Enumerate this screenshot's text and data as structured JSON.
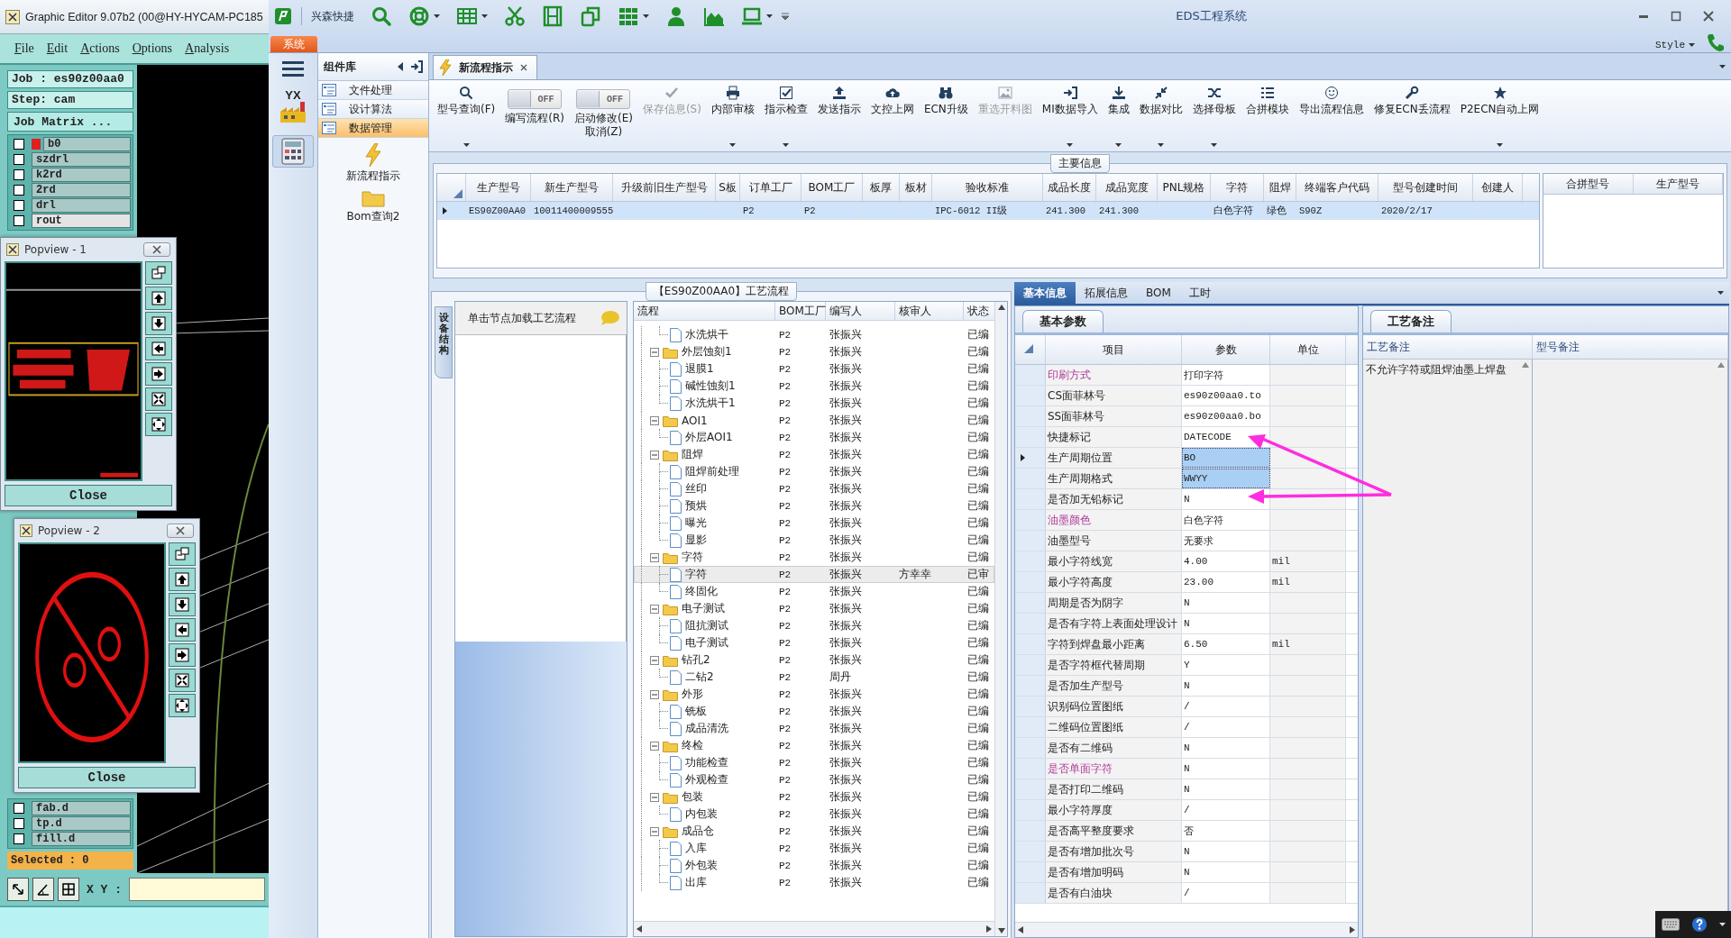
{
  "cam_window": {
    "title": "Graphic Editor 9.07b2 (00@HY-HYCAM-PC185",
    "menu": [
      "File",
      "Edit",
      "Actions",
      "Options",
      "Analysis"
    ],
    "job": "Job : es90z00aa0",
    "step": "Step: cam",
    "job_matrix": "Job Matrix ...",
    "layers": [
      {
        "name": "b0",
        "color": "#e02020",
        "selected": false,
        "checked": false
      },
      {
        "name": "szdrl",
        "selected": false,
        "checked": false
      },
      {
        "name": "k2rd",
        "selected": false,
        "checked": false
      },
      {
        "name": "2rd",
        "selected": false,
        "checked": false
      },
      {
        "name": "drl",
        "selected": false,
        "checked": false
      },
      {
        "name": "rout",
        "selected": true,
        "checked": false
      }
    ],
    "bottom_layers": [
      {
        "name": "fab.d",
        "selected": false,
        "checked": false
      },
      {
        "name": "tp.d",
        "selected": false,
        "checked": false
      },
      {
        "name": "fill.d",
        "selected": false,
        "checked": false
      }
    ],
    "selected_count": "Selected : 0",
    "xy_label": "X Y :",
    "popviews": [
      {
        "title": "Popview - 1",
        "close": "Close"
      },
      {
        "title": "Popview - 2",
        "close": "Close"
      }
    ]
  },
  "eds": {
    "title": "EDS工程系统",
    "quick_label": "兴森快捷",
    "system_tab": "系统",
    "style": "Style",
    "nav_badge": "YX",
    "components": {
      "title": "组件库",
      "items": [
        {
          "label": "文件处理",
          "selected": false
        },
        {
          "label": "设计算法",
          "selected": false
        },
        {
          "label": "数据管理",
          "selected": true
        }
      ],
      "tools": [
        "新流程指示",
        "Bom查询2"
      ]
    },
    "doc_tab": "新流程指示",
    "toolbar": [
      {
        "kind": "button",
        "label": "型号查询(F)",
        "dropdown": true,
        "disabled": false
      },
      {
        "kind": "toggle",
        "label": "编写流程(R)",
        "state_text": "OFF",
        "on": false
      },
      {
        "kind": "toggle",
        "label": "启动修改(E)\n取消(Z)",
        "state_text": "OFF",
        "on": false
      },
      {
        "kind": "button",
        "label": "保存信息(S)",
        "dropdown": false,
        "disabled": true
      },
      {
        "kind": "button",
        "label": "内部审核",
        "dropdown": true,
        "disabled": false
      },
      {
        "kind": "button",
        "label": "指示检查",
        "dropdown": true,
        "disabled": false
      },
      {
        "kind": "button",
        "label": "发送指示",
        "dropdown": false,
        "disabled": false
      },
      {
        "kind": "button",
        "label": "文控上网",
        "dropdown": false,
        "disabled": false
      },
      {
        "kind": "button",
        "label": "ECN升级",
        "dropdown": false,
        "disabled": false
      },
      {
        "kind": "button",
        "label": "重选开料图",
        "dropdown": false,
        "disabled": true
      },
      {
        "kind": "button",
        "label": "MI数据导入",
        "dropdown": true,
        "disabled": false
      },
      {
        "kind": "button",
        "label": "集成",
        "dropdown": true,
        "disabled": false
      },
      {
        "kind": "button",
        "label": "数据对比",
        "dropdown": true,
        "disabled": false
      },
      {
        "kind": "button",
        "label": "选择母板",
        "dropdown": true,
        "disabled": false
      },
      {
        "kind": "button",
        "label": "合拼模块",
        "dropdown": false,
        "disabled": false
      },
      {
        "kind": "button",
        "label": "导出流程信息",
        "dropdown": false,
        "disabled": false
      },
      {
        "kind": "button",
        "label": "修复ECN丢流程",
        "dropdown": false,
        "disabled": false
      },
      {
        "kind": "button",
        "label": "P2ECN自动上网",
        "dropdown": true,
        "disabled": false
      }
    ],
    "main_info": {
      "title": "主要信息",
      "columns": [
        "生产型号",
        "新生产型号",
        "升级前旧生产型号",
        "S板",
        "订单工厂",
        "BOM工厂",
        "板厚",
        "板材",
        "验收标准",
        "成品长度",
        "成品宽度",
        "PNL规格",
        "字符",
        "阻焊",
        "终端客户代码",
        "型号创建时间",
        "创建人"
      ],
      "rows": [
        {
          "selected": true,
          "cells": [
            "ES90Z00AA0",
            "10011400009555",
            null,
            null,
            "P2",
            "P2",
            null,
            null,
            "IPC-6012 II级",
            "241.300",
            "241.300",
            null,
            "白色字符",
            "绿色",
            "S90Z",
            "2020/2/17",
            null
          ]
        }
      ],
      "side_columns": [
        "合拼型号",
        "生产型号"
      ]
    },
    "process": {
      "title": "【ES90Z00AA0】工艺流程",
      "side_tab": "设备结构",
      "hint": "单击节点加载工艺流程",
      "columns": [
        "流程",
        "BOM工厂",
        "编写人",
        "核审人",
        "状态"
      ],
      "tree": [
        {
          "children": [
            {
              "name": "水洗烘干",
              "factory": "P2",
              "author": "张振兴",
              "status": "已编",
              "selected": false
            }
          ]
        },
        {
          "name": "外层蚀刻1",
          "factory": "P2",
          "author": "张振兴",
          "status": "已编",
          "selected": false,
          "children": [
            {
              "name": "退膜1",
              "factory": "P2",
              "author": "张振兴",
              "status": "已编",
              "selected": false
            },
            {
              "name": "碱性蚀刻1",
              "factory": "P2",
              "author": "张振兴",
              "status": "已编",
              "selected": false
            },
            {
              "name": "水洗烘干1",
              "factory": "P2",
              "author": "张振兴",
              "status": "已编",
              "selected": false
            }
          ]
        },
        {
          "name": "AOI1",
          "factory": "P2",
          "author": "张振兴",
          "status": "已编",
          "selected": false,
          "children": [
            {
              "name": "外层AOI1",
              "factory": "P2",
              "author": "张振兴",
              "status": "已编",
              "selected": false
            }
          ]
        },
        {
          "name": "阻焊",
          "factory": "P2",
          "author": "张振兴",
          "status": "已编",
          "selected": false,
          "children": [
            {
              "name": "阻焊前处理",
              "factory": "P2",
              "author": "张振兴",
              "status": "已编",
              "selected": false
            },
            {
              "name": "丝印",
              "factory": "P2",
              "author": "张振兴",
              "status": "已编",
              "selected": false
            },
            {
              "name": "预烘",
              "factory": "P2",
              "author": "张振兴",
              "status": "已编",
              "selected": false
            },
            {
              "name": "曝光",
              "factory": "P2",
              "author": "张振兴",
              "status": "已编",
              "selected": false
            },
            {
              "name": "显影",
              "factory": "P2",
              "author": "张振兴",
              "status": "已编",
              "selected": false
            }
          ]
        },
        {
          "name": "字符",
          "factory": "P2",
          "author": "张振兴",
          "status": "已编",
          "selected": false,
          "children": [
            {
              "name": "字符",
              "factory": "P2",
              "author": "张振兴",
              "reviewer": "方幸幸",
              "status": "已审",
              "selected": true
            },
            {
              "name": "终固化",
              "factory": "P2",
              "author": "张振兴",
              "status": "已编",
              "selected": false
            }
          ]
        },
        {
          "name": "电子测试",
          "factory": "P2",
          "author": "张振兴",
          "status": "已编",
          "selected": false,
          "children": [
            {
              "name": "阻抗测试",
              "factory": "P2",
              "author": "张振兴",
              "status": "已编",
              "selected": false
            },
            {
              "name": "电子测试",
              "factory": "P2",
              "author": "张振兴",
              "status": "已编",
              "selected": false
            }
          ]
        },
        {
          "name": "钻孔2",
          "factory": "P2",
          "author": "张振兴",
          "status": "已编",
          "selected": false,
          "children": [
            {
              "name": "二钻2",
              "factory": "P2",
              "author": "周丹",
              "status": "已编",
              "selected": false
            }
          ]
        },
        {
          "name": "外形",
          "factory": "P2",
          "author": "张振兴",
          "status": "已编",
          "selected": false,
          "children": [
            {
              "name": "铣板",
              "factory": "P2",
              "author": "张振兴",
              "status": "已编",
              "selected": false
            },
            {
              "name": "成品清洗",
              "factory": "P2",
              "author": "张振兴",
              "status": "已编",
              "selected": false
            }
          ]
        },
        {
          "name": "终检",
          "factory": "P2",
          "author": "张振兴",
          "status": "已编",
          "selected": false,
          "children": [
            {
              "name": "功能检查",
              "factory": "P2",
              "author": "张振兴",
              "status": "已编",
              "selected": false
            },
            {
              "name": "外观检查",
              "factory": "P2",
              "author": "张振兴",
              "status": "已编",
              "selected": false
            }
          ]
        },
        {
          "name": "包装",
          "factory": "P2",
          "author": "张振兴",
          "status": "已编",
          "selected": false,
          "children": [
            {
              "name": "内包装",
              "factory": "P2",
              "author": "张振兴",
              "status": "已编",
              "selected": false
            }
          ]
        },
        {
          "name": "成品仓",
          "factory": "P2",
          "author": "张振兴",
          "status": "已编",
          "selected": false,
          "children": [
            {
              "name": "入库",
              "factory": "P2",
              "author": "张振兴",
              "status": "已编",
              "selected": false
            },
            {
              "name": "外包装",
              "factory": "P2",
              "author": "张振兴",
              "status": "已编",
              "selected": false
            },
            {
              "name": "出库",
              "factory": "P2",
              "author": "张振兴",
              "status": "已编",
              "selected": false
            }
          ]
        }
      ]
    },
    "detail": {
      "tabs": [
        {
          "label": "基本信息",
          "selected": true
        },
        {
          "label": "拓展信息",
          "selected": false
        },
        {
          "label": "BOM",
          "selected": false
        },
        {
          "label": "工时",
          "selected": false
        }
      ],
      "params_tab": "基本参数",
      "param_columns": [
        "项目",
        "参数",
        "单位"
      ],
      "params": [
        {
          "item": "印刷方式",
          "value": "打印字符",
          "emphasized": true,
          "selected": false,
          "current": false
        },
        {
          "item": "CS面菲林号",
          "value": "es90z00aa0.to",
          "emphasized": false,
          "selected": false,
          "current": false
        },
        {
          "item": "SS面菲林号",
          "value": "es90z00aa0.bo",
          "emphasized": false,
          "selected": false,
          "current": false
        },
        {
          "item": "快捷标记",
          "value": "DATECODE",
          "emphasized": false,
          "selected": false,
          "current": false
        },
        {
          "item": "生产周期位置",
          "value": "BO",
          "emphasized": false,
          "selected": true,
          "current": true
        },
        {
          "item": "生产周期格式",
          "value": "WWYY",
          "emphasized": false,
          "selected": true,
          "current": false
        },
        {
          "item": "是否加无铅标记",
          "value": "N",
          "emphasized": false,
          "selected": false,
          "current": false
        },
        {
          "item": "油墨颜色",
          "value": "白色字符",
          "emphasized": true,
          "selected": false,
          "current": false
        },
        {
          "item": "油墨型号",
          "value": "无要求",
          "emphasized": false,
          "selected": false,
          "current": false
        },
        {
          "item": "最小字符线宽",
          "value": "4.00",
          "unit": "mil",
          "emphasized": false,
          "selected": false,
          "current": false
        },
        {
          "item": "最小字符高度",
          "value": "23.00",
          "unit": "mil",
          "emphasized": false,
          "selected": false,
          "current": false
        },
        {
          "item": "周期是否为阴字",
          "value": "N",
          "emphasized": false,
          "selected": false,
          "current": false
        },
        {
          "item": "是否有字符上表面处理设计",
          "value": "N",
          "emphasized": false,
          "selected": false,
          "current": false
        },
        {
          "item": "字符到焊盘最小距离",
          "value": "6.50",
          "unit": "mil",
          "emphasized": false,
          "selected": false,
          "current": false
        },
        {
          "item": "是否字符框代替周期",
          "value": "Y",
          "emphasized": false,
          "selected": false,
          "current": false
        },
        {
          "item": "是否加生产型号",
          "value": "N",
          "emphasized": false,
          "selected": false,
          "current": false
        },
        {
          "item": "识别码位置图纸",
          "value": "/",
          "emphasized": false,
          "selected": false,
          "current": false
        },
        {
          "item": "二维码位置图纸",
          "value": "/",
          "emphasized": false,
          "selected": false,
          "current": false
        },
        {
          "item": "是否有二维码",
          "value": "N",
          "emphasized": false,
          "selected": false,
          "current": false
        },
        {
          "item": "是否单面字符",
          "value": "N",
          "emphasized": true,
          "selected": false,
          "current": false
        },
        {
          "item": "是否打印二维码",
          "value": "N",
          "emphasized": false,
          "selected": false,
          "current": false
        },
        {
          "item": "最小字符厚度",
          "value": "/",
          "emphasized": false,
          "selected": false,
          "current": false
        },
        {
          "item": "是否高平整度要求",
          "value": "否",
          "emphasized": false,
          "selected": false,
          "current": false
        },
        {
          "item": "是否有增加批次号",
          "value": "N",
          "emphasized": false,
          "selected": false,
          "current": false
        },
        {
          "item": "是否有增加明码",
          "value": "N",
          "emphasized": false,
          "selected": false,
          "current": false
        },
        {
          "item": "是否有白油块",
          "value": "/",
          "emphasized": false,
          "selected": false,
          "current": false
        }
      ],
      "notes_tab": "工艺备注",
      "note_columns": [
        "工艺备注",
        "型号备注"
      ],
      "notes": [
        "不允许字符或阻焊油墨上焊盘"
      ]
    }
  }
}
